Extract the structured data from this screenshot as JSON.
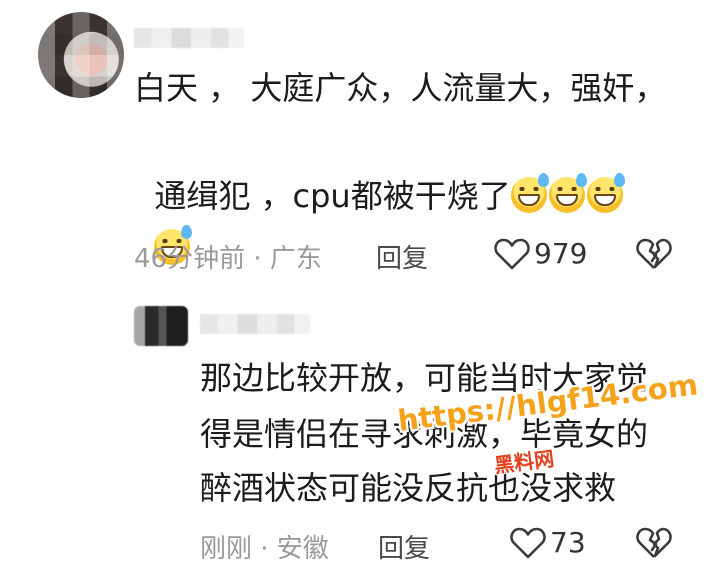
{
  "comments": [
    {
      "text_lines": [
        "白天 ， 大庭广众，人流量大，强奸，",
        "通缉犯 ，cpu都被干烧了",
        ""
      ],
      "emoji_row1_count": 3,
      "emoji_row2_count": 1,
      "emoji_icon": "sweat-grin-emoji",
      "time": "46分钟前 · 广东",
      "reply_label": "回复",
      "like_count": "979"
    },
    {
      "text_lines": [
        "那边比较开放，可能当时大家觉",
        "得是情侣在寻求刺激，毕竟女的",
        "醉酒状态可能没反抗也没求救"
      ],
      "time": "刚刚 · 安徽",
      "reply_label": "回复",
      "like_count": "73"
    }
  ],
  "watermark": {
    "url": "https://hlgf14.com",
    "label": "黑料网"
  },
  "icons": {
    "like": "heart-icon",
    "dislike": "broken-heart-icon"
  }
}
